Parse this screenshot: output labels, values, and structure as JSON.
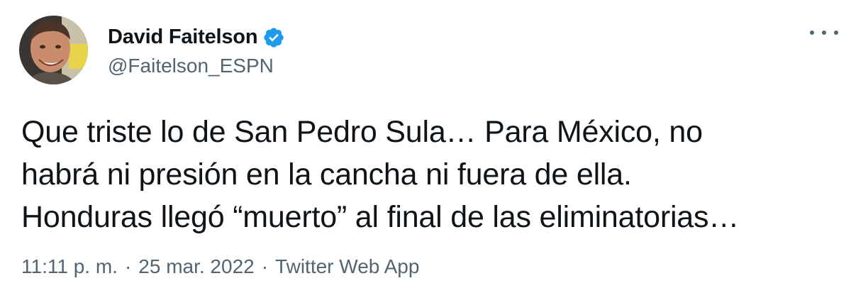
{
  "author": {
    "display_name": "David Faitelson",
    "handle": "@Faitelson_ESPN",
    "verified_icon": "verified-badge-icon",
    "avatar_icon": "avatar"
  },
  "tweet": {
    "lines": [
      "Que triste lo de San Pedro Sula… Para México, no",
      "habrá ni presión en la cancha ni fuera de ella.",
      "Honduras llegó “muerto” al final de las eliminatorias…"
    ]
  },
  "meta": {
    "time": "11:11 p. m.",
    "separator": "·",
    "date": "25 mar. 2022",
    "source": "Twitter Web App"
  },
  "colors": {
    "text": "#0f1419",
    "secondary": "#536471",
    "verified": "#1d9bf0"
  },
  "more_icon": "more-options-icon"
}
